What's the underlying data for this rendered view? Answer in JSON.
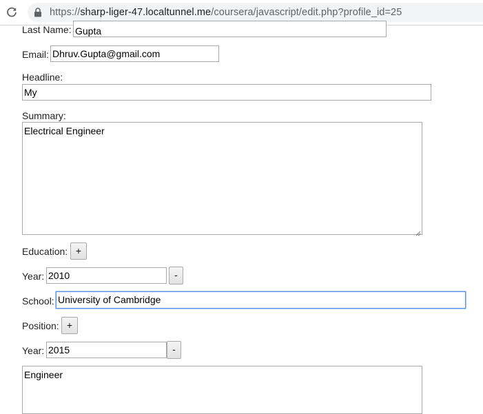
{
  "browser": {
    "url_prefix": "https://",
    "url_host": "sharp-liger-47.localtunnel.me",
    "url_path": "/coursera/javascript/edit.php?profile_id=25"
  },
  "form": {
    "last_name_label": "Last Name:",
    "last_name_value": "Gupta",
    "email_label": "Email:",
    "email_value": "Dhruv.Gupta@gmail.com",
    "headline_label": "Headline:",
    "headline_value": "My",
    "summary_label": "Summary:",
    "summary_value": "Electrical Engineer",
    "education_label": "Education:",
    "education_add": "+",
    "education_entries": [
      {
        "year_label": "Year:",
        "year_value": "2010",
        "remove": "-",
        "school_label": "School:",
        "school_value": "University of Cambridge"
      }
    ],
    "position_label": "Position:",
    "position_add": "+",
    "position_entries": [
      {
        "year_label": "Year:",
        "year_value": "2015",
        "remove": "-",
        "description": "Engineer"
      }
    ]
  },
  "icons": [
    "reload-icon",
    "lock-icon",
    "resize-grip-icon"
  ]
}
